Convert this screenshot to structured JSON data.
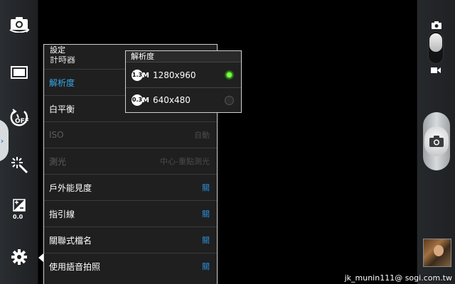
{
  "settings_panel": {
    "title": "設定",
    "partial_row_label": "計時器",
    "rows": [
      {
        "label": "解析度",
        "value": "",
        "state": "active"
      },
      {
        "label": "白平衡",
        "value": "",
        "state": "normal"
      },
      {
        "label": "ISO",
        "value": "自動",
        "state": "disabled"
      },
      {
        "label": "測光",
        "value": "中心-重點測光",
        "state": "disabled"
      },
      {
        "label": "戶外能見度",
        "value": "關",
        "state": "normal"
      },
      {
        "label": "指引線",
        "value": "關",
        "state": "normal"
      },
      {
        "label": "關聯式檔名",
        "value": "關",
        "state": "normal"
      },
      {
        "label": "使用語音拍照",
        "value": "關",
        "state": "normal"
      }
    ]
  },
  "resolution_popup": {
    "title": "解析度",
    "options": [
      {
        "badge": "1.3",
        "badge_unit": "M",
        "label": "1280x960",
        "selected": true
      },
      {
        "badge": "0.3",
        "badge_unit": "M",
        "label": "640x480",
        "selected": false
      }
    ]
  },
  "left_toolbar": {
    "icons": [
      "switch-camera-icon",
      "aspect-ratio-icon",
      "timer-off-icon",
      "effects-icon",
      "exposure-icon",
      "settings-gear-icon"
    ],
    "timer_state": "OFF",
    "exposure_value": "0.0",
    "expand_arrow": "›"
  },
  "watermark": "jk_munin111@ sogi.com.tw",
  "colors": {
    "accent_blue": "#38a8e6",
    "toggle_blue": "#2a8fd8",
    "radio_green": "#7dff4a",
    "panel_bg": "#1f1f20"
  }
}
